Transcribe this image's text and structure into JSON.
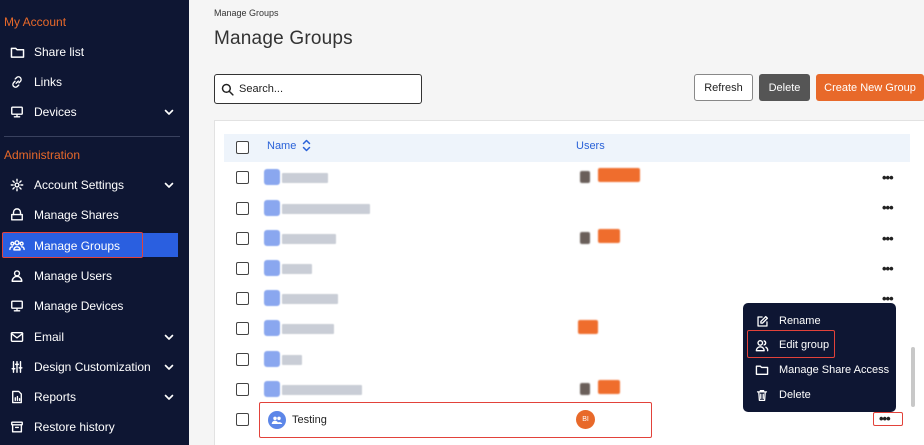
{
  "sidebar": {
    "sections": [
      {
        "label": "My Account"
      },
      {
        "label": "Administration"
      }
    ],
    "items": [
      {
        "label": "Share list",
        "icon": "folder-icon"
      },
      {
        "label": "Links",
        "icon": "link-icon"
      },
      {
        "label": "Devices",
        "icon": "monitor-icon"
      },
      {
        "label": "Account Settings",
        "icon": "gear-icon"
      },
      {
        "label": "Manage Shares",
        "icon": "shares-icon"
      },
      {
        "label": "Manage Groups",
        "icon": "group-icon"
      },
      {
        "label": "Manage Users",
        "icon": "user-icon"
      },
      {
        "label": "Manage Devices",
        "icon": "devices-icon"
      },
      {
        "label": "Email",
        "icon": "mail-icon"
      },
      {
        "label": "Design Customization",
        "icon": "sliders-icon"
      },
      {
        "label": "Reports",
        "icon": "report-icon"
      },
      {
        "label": "Restore history",
        "icon": "restore-icon"
      }
    ],
    "active": "Manage Groups"
  },
  "header": {
    "breadcrumb": "Manage Groups",
    "title": "Manage Groups"
  },
  "toolbar": {
    "search_placeholder": "Search...",
    "refresh_label": "Refresh",
    "delete_label": "Delete",
    "create_label": "Create New Group"
  },
  "table": {
    "columns": [
      "Name",
      "Users"
    ],
    "last_row": {
      "name": "Testing",
      "user_initials": "BI"
    }
  },
  "context_menu": {
    "items": [
      {
        "label": "Rename",
        "icon": "edit-icon"
      },
      {
        "label": "Edit group",
        "icon": "users-icon"
      },
      {
        "label": "Manage Share Access",
        "icon": "folder-icon"
      },
      {
        "label": "Delete",
        "icon": "trash-icon"
      }
    ]
  },
  "colors": {
    "sidebar_bg": "#0e1633",
    "accent_orange": "#e8692a",
    "active_blue": "#2a5fe0",
    "highlight_red": "#e2423a"
  }
}
